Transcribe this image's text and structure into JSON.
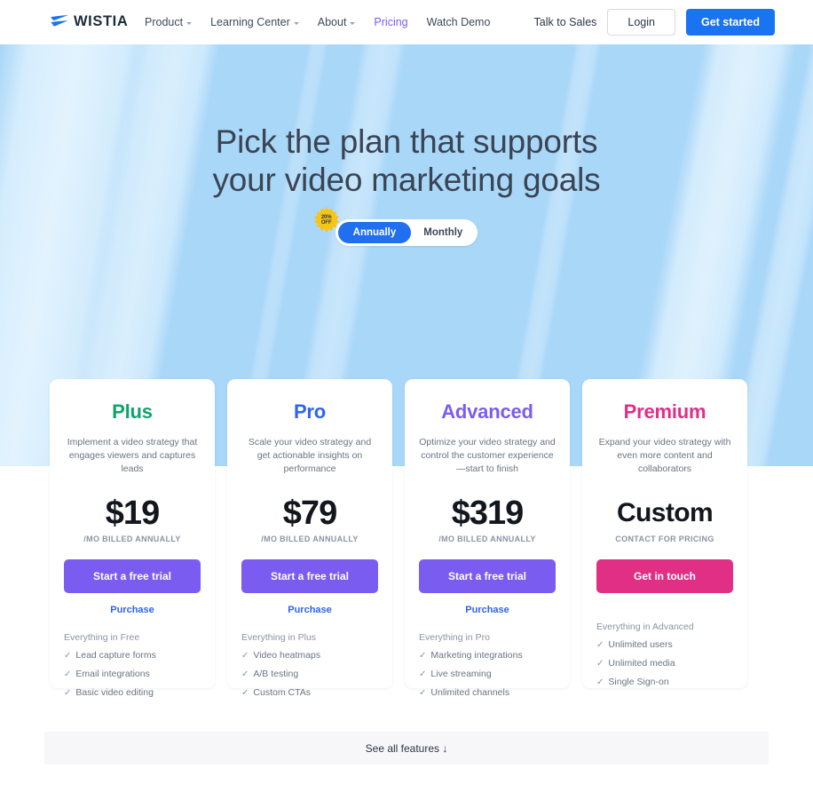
{
  "nav": {
    "logo_text": "WISTIA",
    "logo_icon": "wistia-swoosh-icon",
    "links": [
      {
        "label": "Product",
        "has_caret": true,
        "accent": false
      },
      {
        "label": "Learning Center",
        "has_caret": true,
        "accent": false
      },
      {
        "label": "About",
        "has_caret": true,
        "accent": false
      },
      {
        "label": "Pricing",
        "has_caret": false,
        "accent": true
      },
      {
        "label": "Watch Demo",
        "has_caret": false,
        "accent": false
      }
    ],
    "talk_to_sales": "Talk to Sales",
    "login": "Login",
    "get_started": "Get started"
  },
  "hero": {
    "title_line1": "Pick the plan that supports",
    "title_line2": "your video marketing goals",
    "badge": {
      "line1": "20%",
      "line2": "OFF",
      "color": "#f5c518"
    },
    "toggle": {
      "options": [
        "Annually",
        "Monthly"
      ],
      "selected": "Annually",
      "active_color": "#1f6ff0"
    }
  },
  "plans": [
    {
      "name": "Plus",
      "name_color": "#11a36b",
      "description": "Implement a video strategy that engages viewers and captures leads",
      "price": "$19",
      "term": "/MO BILLED ANNUALLY",
      "cta_label": "Start a free trial",
      "cta_color": "#7b5cf0",
      "secondary_link": "Purchase",
      "features_header": "Everything in Free",
      "features": [
        "Lead capture forms",
        "Email integrations",
        "Basic video editing"
      ]
    },
    {
      "name": "Pro",
      "name_color": "#2f62f5",
      "description": "Scale your video strategy and get actionable insights on performance",
      "price": "$79",
      "term": "/MO BILLED ANNUALLY",
      "cta_label": "Start a free trial",
      "cta_color": "#7b5cf0",
      "secondary_link": "Purchase",
      "features_header": "Everything in Plus",
      "features": [
        "Video heatmaps",
        "A/B testing",
        "Custom CTAs"
      ]
    },
    {
      "name": "Advanced",
      "name_color": "#7b5cf0",
      "description": "Optimize your video strategy and control the customer experience—start to finish",
      "price": "$319",
      "term": "/MO BILLED ANNUALLY",
      "cta_label": "Start a free trial",
      "cta_color": "#7b5cf0",
      "secondary_link": "Purchase",
      "features_header": "Everything in Pro",
      "features": [
        "Marketing integrations",
        "Live streaming",
        "Unlimited channels"
      ]
    },
    {
      "name": "Premium",
      "name_color": "#e02f85",
      "description": "Expand your video strategy with even more content and collaborators",
      "price": "Custom",
      "term": "CONTACT FOR PRICING",
      "cta_label": "Get in touch",
      "cta_color": "#e02f85",
      "secondary_link": null,
      "features_header": "Everything in Advanced",
      "features": [
        "Unlimited users",
        "Unlimited media",
        "Single Sign-on"
      ]
    }
  ],
  "footer_bar": {
    "label": "See all features ↓"
  },
  "theme": {
    "hero_bg": "#a9d7f8",
    "nav_bg": "#ffffff",
    "page_bg": "#ffffff",
    "primary_blue": "#1a73f0",
    "purple": "#7b5cf0",
    "pink": "#e02f85"
  }
}
